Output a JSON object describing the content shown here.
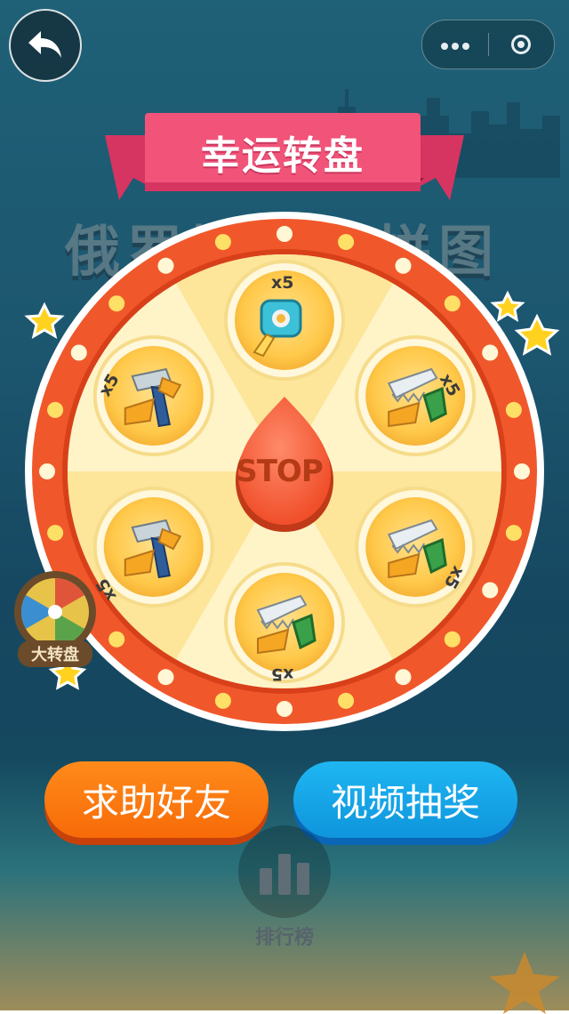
{
  "header": {
    "back_icon": "back-arrow-icon",
    "menu_icon": "more-dots-icon",
    "close_icon": "target-circle-icon"
  },
  "background": {
    "title": "俄罗斯方块拼图"
  },
  "wheel": {
    "title": "幸运转盘",
    "stop_label": "STOP",
    "prizes": [
      {
        "item": "measuring-tape-icon",
        "count": "x5"
      },
      {
        "item": "saw-icon",
        "count": "x5"
      },
      {
        "item": "saw-icon",
        "count": "x5"
      },
      {
        "item": "saw-icon",
        "count": "x5"
      },
      {
        "item": "hammer-icon",
        "count": "x5"
      },
      {
        "item": "hammer-icon",
        "count": "x5"
      }
    ],
    "colors": {
      "rim": "#f0582b",
      "segment_light": "#fff4c8",
      "segment_dark": "#fde59a",
      "pointer": "#ff6a4a"
    }
  },
  "side_button": {
    "label": "大转盘"
  },
  "actions": {
    "help_label": "求助好友",
    "video_label": "视频抽奖"
  },
  "ranking": {
    "label": "排行榜",
    "icon": "bar-chart-icon"
  }
}
